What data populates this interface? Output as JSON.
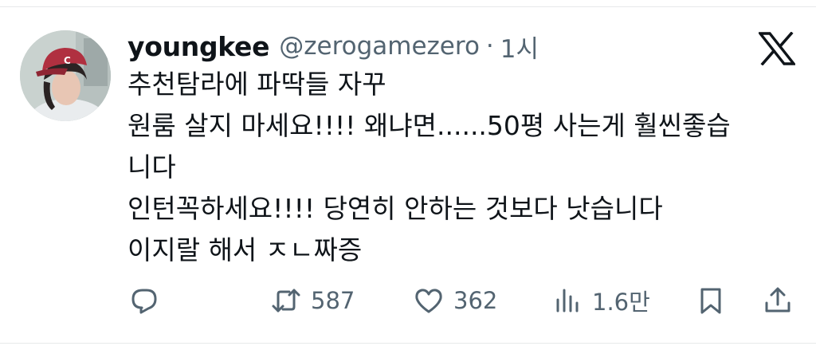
{
  "tweet": {
    "author_name": "youngkee",
    "handle": "@zerogamezero",
    "separator": "·",
    "time": "1시",
    "lines": [
      "추천탐라에 파딱들 자꾸",
      "원룸 살지 마세요!!!! 왜냐면......50평 사는게 훨씬좋습",
      "니다",
      "인턴꼭하세요!!!! 당연히 안하는 것보다 낫습니다",
      "이지랄 해서 ㅈㄴ짜증"
    ]
  },
  "actions": {
    "reply_icon": "reply-icon",
    "retweet_icon": "retweet-icon",
    "retweet_count": "587",
    "like_icon": "heart-icon",
    "like_count": "362",
    "views_icon": "views-icon",
    "views_count": "1.6만",
    "bookmark_icon": "bookmark-icon",
    "share_icon": "share-icon"
  },
  "colors": {
    "text": "#0f1419",
    "secondary": "#536471",
    "divider": "#e7e9ea"
  }
}
